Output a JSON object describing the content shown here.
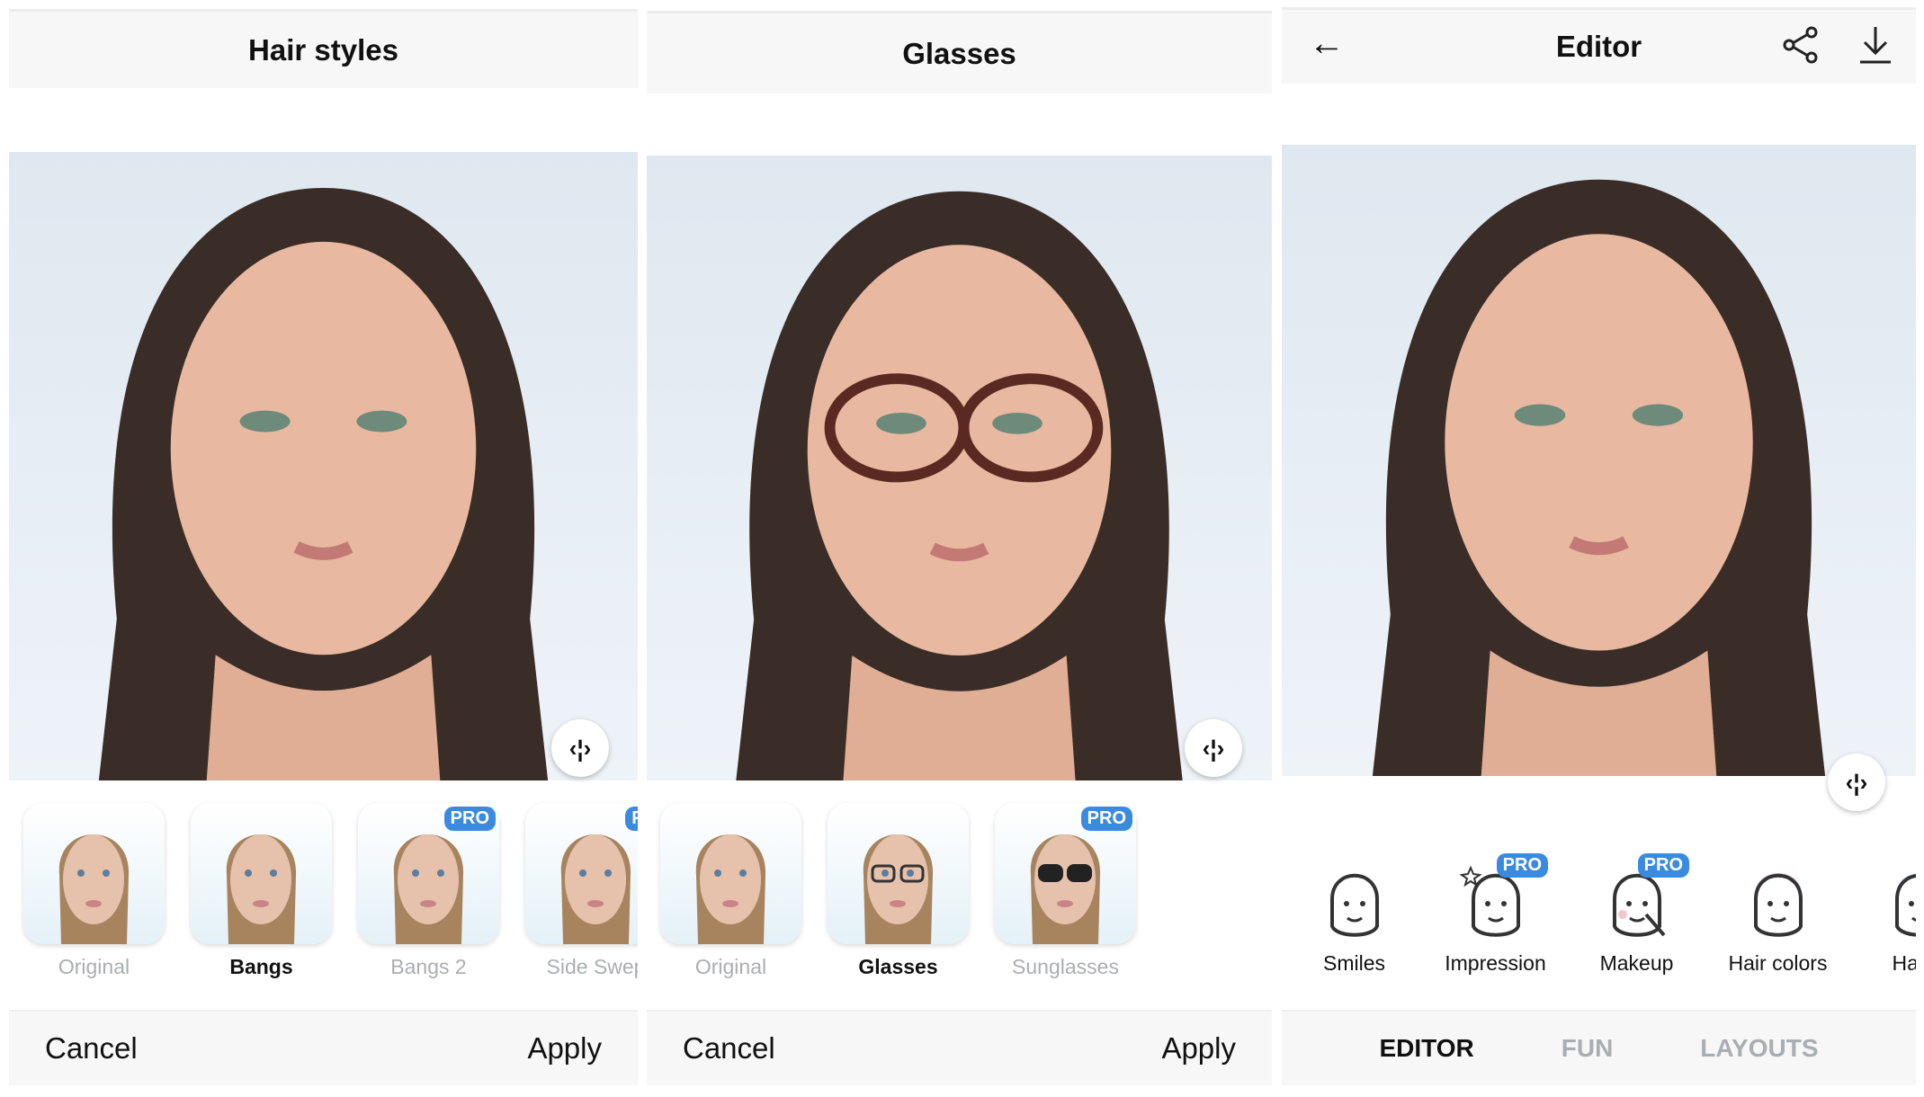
{
  "colors": {
    "pro_badge": "#3a8be0",
    "header_bg": "#f7f7f7",
    "inactive_text": "#a9aeb3"
  },
  "hair": {
    "title": "Hair styles",
    "items": [
      {
        "label": "Original"
      },
      {
        "label": "Bangs",
        "selected": true
      },
      {
        "label": "Bangs 2",
        "pro": "PRO"
      },
      {
        "label": "Side Swep",
        "pro": "PR"
      }
    ],
    "cancel": "Cancel",
    "apply": "Apply"
  },
  "glasses": {
    "title": "Glasses",
    "items": [
      {
        "label": "Original"
      },
      {
        "label": "Glasses",
        "selected": true
      },
      {
        "label": "Sunglasses",
        "pro": "PRO"
      }
    ],
    "cancel": "Cancel",
    "apply": "Apply"
  },
  "editor": {
    "title": "Editor",
    "back_icon": "arrow-left-icon",
    "share_icon": "share-icon",
    "download_icon": "download-icon",
    "tools": [
      {
        "label": "Smiles"
      },
      {
        "label": "Impression",
        "pro": "PRO"
      },
      {
        "label": "Makeup",
        "pro": "PRO"
      },
      {
        "label": "Hair colors"
      },
      {
        "label": "Hair s"
      }
    ],
    "tabs": [
      {
        "label": "EDITOR",
        "active": true
      },
      {
        "label": "FUN"
      },
      {
        "label": "LAYOUTS"
      }
    ]
  },
  "compare_icon": "‹¦›"
}
